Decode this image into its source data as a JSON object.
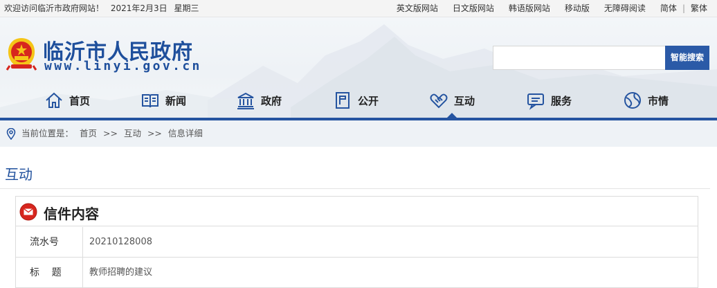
{
  "topbar": {
    "welcome": "欢迎访问临沂市政府网站！",
    "date": "2021年2月3日",
    "weekday": "星期三",
    "links": [
      "英文版网站",
      "日文版网站",
      "韩语版网站",
      "移动版",
      "无障碍阅读"
    ],
    "lang_simplified": "简体",
    "lang_separator": "|",
    "lang_traditional": "繁体"
  },
  "header": {
    "title": "临沂市人民政府",
    "url": "www.linyi.gov.cn",
    "search_placeholder": "",
    "search_button": "智能搜索"
  },
  "nav": {
    "items": [
      {
        "label": "首页",
        "icon": "home-icon"
      },
      {
        "label": "新闻",
        "icon": "book-icon"
      },
      {
        "label": "政府",
        "icon": "government-building-icon"
      },
      {
        "label": "公开",
        "icon": "document-icon"
      },
      {
        "label": "互动",
        "icon": "handshake-icon"
      },
      {
        "label": "服务",
        "icon": "chat-icon"
      },
      {
        "label": "市情",
        "icon": "globe-icon"
      }
    ],
    "active": "互动"
  },
  "breadcrumb": {
    "prefix": "当前位置是：",
    "items": [
      "首页",
      ">>",
      "互动",
      ">>",
      "信息详细"
    ]
  },
  "section": {
    "title": "互动"
  },
  "letter": {
    "title": "信件内容",
    "rows": [
      {
        "label": "流水号",
        "value": "20210128008"
      },
      {
        "label": "标    题",
        "value": "教师招聘的建议"
      }
    ]
  },
  "colors": {
    "brand_blue": "#2554a0",
    "title_blue": "#1e4f9c",
    "emblem_red": "#d7261e",
    "emblem_gold": "#f5c518"
  }
}
